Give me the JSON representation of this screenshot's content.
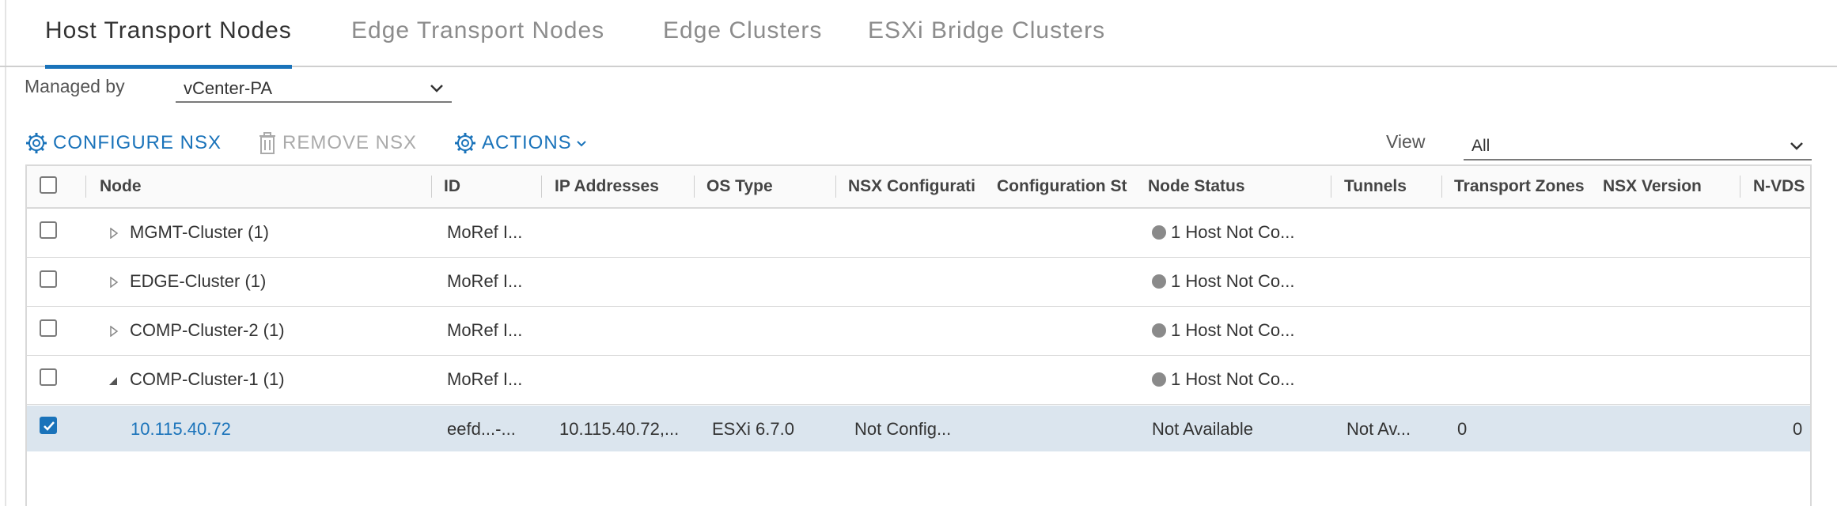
{
  "tabs": [
    {
      "label": "Host Transport Nodes",
      "active": true
    },
    {
      "label": "Edge Transport Nodes",
      "active": false
    },
    {
      "label": "Edge Clusters",
      "active": false
    },
    {
      "label": "ESXi Bridge Clusters",
      "active": false
    }
  ],
  "managed_by": {
    "label": "Managed by",
    "value": "vCenter-PA"
  },
  "toolbar": {
    "configure_label": "CONFIGURE NSX",
    "remove_label": "REMOVE NSX",
    "actions_label": "ACTIONS",
    "view_label": "View",
    "view_value": "All"
  },
  "columns": [
    "Node",
    "ID",
    "IP Addresses",
    "OS Type",
    "NSX Configurati",
    "Configuration St",
    "Node Status",
    "Tunnels",
    "Transport Zones",
    "NSX Version",
    "N-VDS"
  ],
  "rows": [
    {
      "node": "MGMT-Cluster (1)",
      "id": "MoRef I...",
      "status": "1 Host Not Co...",
      "expanded": false
    },
    {
      "node": "EDGE-Cluster (1)",
      "id": "MoRef I...",
      "status": "1 Host Not Co...",
      "expanded": false
    },
    {
      "node": "COMP-Cluster-2 (1)",
      "id": "MoRef I...",
      "status": "1 Host Not Co...",
      "expanded": false
    },
    {
      "node": "COMP-Cluster-1 (1)",
      "id": "MoRef I...",
      "status": "1 Host Not Co...",
      "expanded": true
    }
  ],
  "host_row": {
    "node": "10.115.40.72",
    "id": "eefd...-...",
    "ip": "10.115.40.72,...",
    "os": "ESXi 6.7.0",
    "nsx_config": "Not Config...",
    "node_status": "Not Available",
    "tunnels": "Not Av...",
    "transport_zones": "0",
    "nvds": "0",
    "checked": true
  },
  "colors": {
    "accent": "#1a73ba",
    "selected_row": "#dbe5ee",
    "status_dot": "#8a8a8a"
  },
  "icons": [
    "gear-icon",
    "trash-icon",
    "chevron-down-icon",
    "triangle-right-icon",
    "triangle-down-icon",
    "checkmark-icon"
  ]
}
